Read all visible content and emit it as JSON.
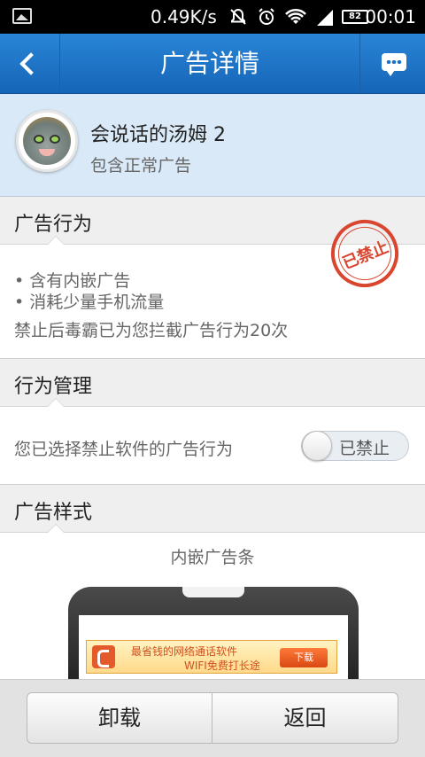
{
  "statusbar": {
    "speed": "0.49K/s",
    "battery": "82",
    "time": "00:01"
  },
  "titlebar": {
    "title": "广告详情"
  },
  "app": {
    "name": "会说话的汤姆 2",
    "subtitle": "包含正常广告"
  },
  "behavior": {
    "header": "广告行为",
    "stamp": "已禁止",
    "items": [
      "• 含有内嵌广告",
      "• 消耗少量手机流量"
    ],
    "blocked_text": "禁止后毒霸已为您拦截广告行为20次"
  },
  "management": {
    "header": "行为管理",
    "text": "您已选择禁止软件的广告行为",
    "toggle_label": "已禁止"
  },
  "ad_style": {
    "header": "广告样式",
    "caption": "内嵌广告条",
    "banner_line1": "最省钱的网络通话软件",
    "banner_line2": "WIFI免费打长途",
    "banner_download": "下载"
  },
  "bottom": {
    "uninstall": "卸载",
    "back": "返回"
  },
  "colors": {
    "titlebar": "#1e73c6",
    "stamp": "#d9462f"
  }
}
